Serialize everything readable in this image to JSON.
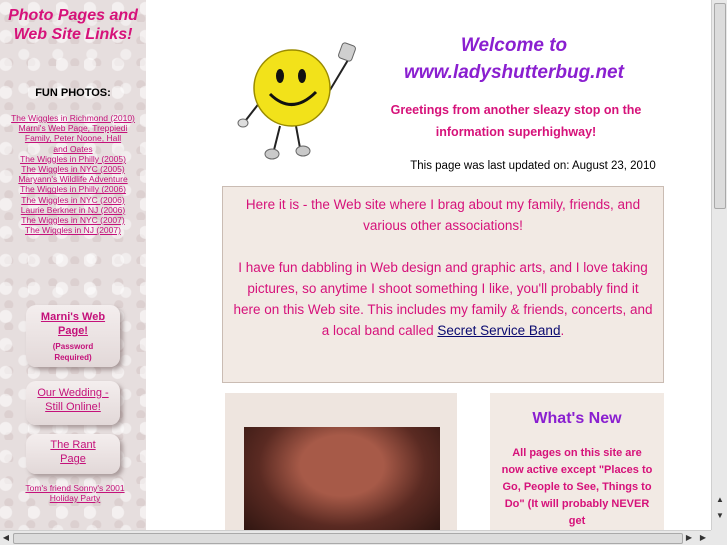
{
  "sidebar": {
    "title": "Photo Pages and Web Site Links!",
    "fun_heading": "FUN PHOTOS:",
    "links": [
      "The Wiggles in Richmond (2010)",
      "Marni's Web Page, Treppiedi Family, Peter Noone, Hall and Oates",
      "The Wiggles in Philly (2005)",
      "The Wiggles in NYC (2005)",
      "Maryann's Wildlife Adventure",
      "The Wiggles in Philly (2006)",
      "The Wiggles in NYC (2006)",
      "Laurie Berkner in NJ (2006)",
      "The Wiggles in NYC (2007)",
      "The Wiggles in NJ (2007)"
    ],
    "btn_marni": "Marni's Web Page!",
    "btn_marni_sub": "(Password Required)",
    "btn_wedding": "Our Wedding - Still Online!",
    "btn_rant": "The Rant Page",
    "holiday_link": "Tom's friend Sonny's 2001 Holiday Party"
  },
  "header": {
    "welcome": "Welcome to www.ladyshutterbug.net",
    "greeting": "Greetings from another sleazy stop on the information superhighway!",
    "updated": "This page was last updated on: August 23, 2010"
  },
  "intro": {
    "p1": "Here it is - the Web site where I brag about my family, friends, and various other associations!",
    "p2": "I have fun dabbling in Web design and graphic arts, and I love taking pictures, so anytime I shoot something I like, you'll probably find it here on this Web site. This includes my family & friends, concerts, and a local band called",
    "band_link": "Secret Service Band",
    "p2_end": "."
  },
  "whatsnew": {
    "title": "What's New",
    "body": "All pages on this site are now active except \"Places to Go, People to See, Things to Do\" (It will probably NEVER get"
  },
  "colors": {
    "pink": "#d6127a",
    "purple": "#8a1fd0",
    "panel": "#f2eae4"
  }
}
